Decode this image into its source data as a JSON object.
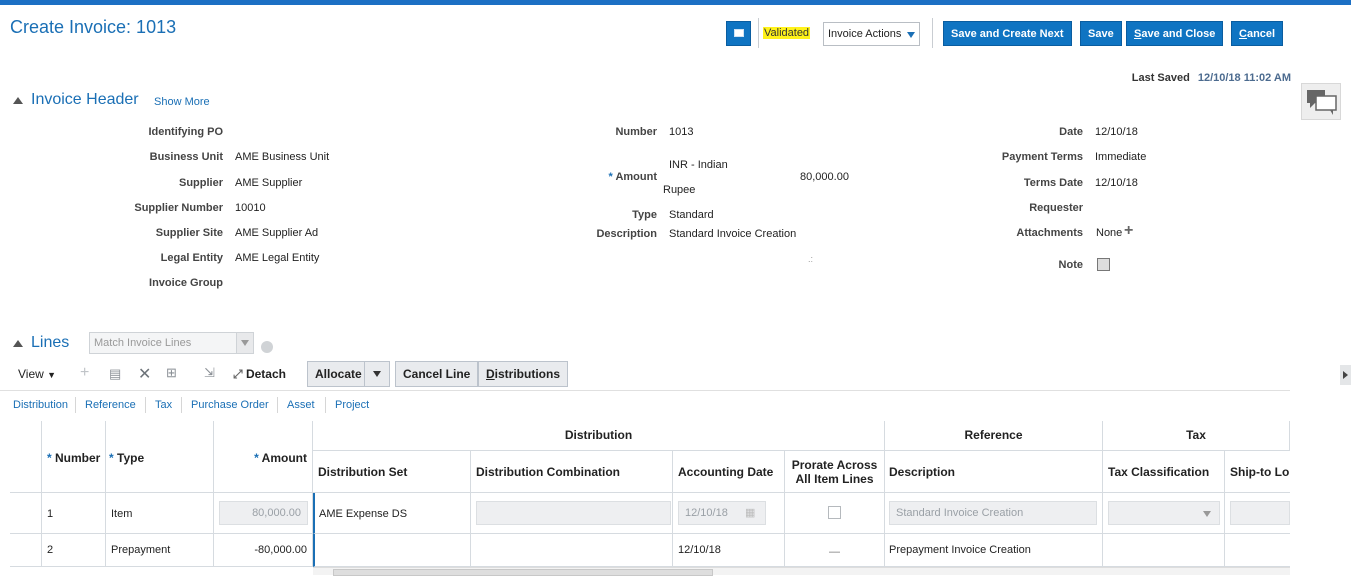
{
  "page": {
    "title": "Create Invoice: 1013"
  },
  "toolbar": {
    "status": "Validated",
    "invoice_actions": "Invoice Actions",
    "save_and_create_next": "Save and Create Next",
    "save": "Save",
    "save_and_close_prefix": "S",
    "save_and_close_rest": "ave and Close",
    "cancel_prefix": "C",
    "cancel_rest": "ancel"
  },
  "last_saved": {
    "label": "Last Saved",
    "value": "12/10/18 11:02 AM"
  },
  "header_section": {
    "title": "Invoice Header",
    "show_more": "Show More",
    "col1": [
      {
        "label": "Identifying PO",
        "value": ""
      },
      {
        "label": "Business Unit",
        "value": "AME Business Unit"
      },
      {
        "label": "Supplier",
        "value": "AME Supplier"
      },
      {
        "label": "Supplier Number",
        "value": "10010"
      },
      {
        "label": "Supplier Site",
        "value": "AME Supplier Ad"
      },
      {
        "label": "Legal Entity",
        "value": "AME Legal Entity"
      },
      {
        "label": "Invoice Group",
        "value": ""
      }
    ],
    "col2": {
      "number_label": "Number",
      "number_value": "1013",
      "amount_label": "Amount",
      "currency_line1": "INR - Indian",
      "currency_line2": "Rupee",
      "amount_value": "80,000.00",
      "type_label": "Type",
      "type_value": "Standard",
      "description_label": "Description",
      "description_value": "Standard Invoice Creation"
    },
    "col3": {
      "date_label": "Date",
      "date_value": "12/10/18",
      "payment_terms_label": "Payment Terms",
      "payment_terms_value": "Immediate",
      "terms_date_label": "Terms Date",
      "terms_date_value": "12/10/18",
      "requester_label": "Requester",
      "requester_value": "",
      "attachments_label": "Attachments",
      "attachments_value": "None",
      "note_label": "Note"
    }
  },
  "lines_section": {
    "title": "Lines",
    "match_placeholder": "Match Invoice Lines",
    "view": "View",
    "detach": "Detach",
    "allocate": "Allocate",
    "cancel_line": "Cancel Line",
    "distributions_prefix": "D",
    "distributions_rest": "istributions",
    "tabs": [
      "Distribution",
      "Reference",
      "Tax",
      "Purchase Order",
      "Asset",
      "Project"
    ]
  },
  "grid": {
    "groups": {
      "distribution": "Distribution",
      "reference": "Reference",
      "tax": "Tax"
    },
    "columns": {
      "number": "Number",
      "type": "Type",
      "amount": "Amount",
      "distribution_set": "Distribution Set",
      "distribution_combination": "Distribution Combination",
      "accounting_date": "Accounting Date",
      "prorate_line1": "Prorate Across",
      "prorate_line2": "All Item Lines",
      "description": "Description",
      "tax_classification": "Tax Classification",
      "ship_to": "Ship-to Lo"
    },
    "rows": [
      {
        "number": "1",
        "type": "Item",
        "amount": "80,000.00",
        "distribution_set": "AME Expense DS",
        "accounting_date": "12/10/18",
        "description": "Standard Invoice Creation"
      },
      {
        "number": "2",
        "type": "Prepayment",
        "amount": "-80,000.00",
        "distribution_set": "",
        "accounting_date": "12/10/18",
        "prorate": "—",
        "description": "Prepayment Invoice Creation"
      }
    ]
  },
  "colors": {
    "accent": "#1a6fb5",
    "button": "#0f74c2",
    "highlight": "#fff21a"
  }
}
